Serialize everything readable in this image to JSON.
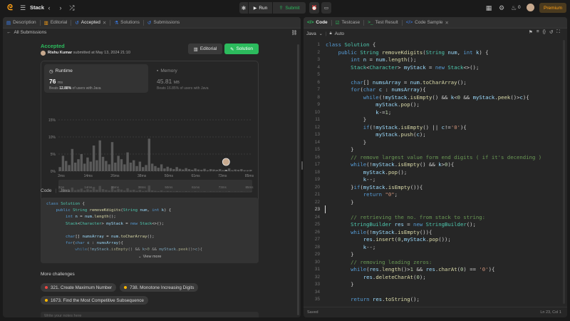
{
  "topbar": {
    "problem_list_label": "Stack",
    "run_label": "Run",
    "submit_label": "Submit",
    "streak_count": "0",
    "premium_label": "Premium"
  },
  "left_tabs": {
    "description": "Description",
    "editorial": "Editorial",
    "accepted": "Accepted",
    "solutions": "Solutions",
    "submissions": "Submissions"
  },
  "submission": {
    "back_label": "All Submissions",
    "status": "Accepted",
    "user": "Rishu Kumar",
    "submitted_at": "submitted at May 13, 2024 21:10",
    "editorial_btn": "Editorial",
    "solution_btn": "Solution",
    "runtime_label": "Runtime",
    "runtime_value": "76",
    "runtime_unit": "ms",
    "runtime_beats_prefix": "Beats",
    "runtime_beats_pct": "12.88%",
    "runtime_beats_suffix": "of users with Java",
    "memory_label": "Memory",
    "memory_value": "45.81",
    "memory_unit": "MB",
    "memory_beats": "Beats 16.85% of users with Java",
    "code_label": "Code",
    "code_lang": "Java",
    "view_more": "View more",
    "more_challenges_title": "More challenges",
    "notes_placeholder": "Write your notes here"
  },
  "challenges": [
    {
      "label": "321. Create Maximum Number",
      "color": "#ef4743"
    },
    {
      "label": "738. Monotone Increasing Digits",
      "color": "#ffb800"
    },
    {
      "label": "1673. Find the Most Competitive Subsequence",
      "color": "#ffb800"
    }
  ],
  "chart_data": {
    "type": "bar",
    "title": "",
    "xlabel": "",
    "ylabel": "",
    "ylim": [
      0,
      15
    ],
    "yticks": [
      "15%",
      "10%",
      "5%",
      "0%"
    ],
    "xticks": [
      "2ms",
      "14ms",
      "26ms",
      "38ms",
      "50ms",
      "61ms",
      "73ms",
      "85ms"
    ],
    "values": [
      1.2,
      4.5,
      3.0,
      1.8,
      6.5,
      2.5,
      3.5,
      5.0,
      2.2,
      4.0,
      2.8,
      7.5,
      3.2,
      9.0,
      4.2,
      3.0,
      2.0,
      8.5,
      2.5,
      4.5,
      3.5,
      2.0,
      5.5,
      2.5,
      3.2,
      1.5,
      2.8,
      1.2,
      1.8,
      9.5,
      2.2,
      1.5,
      1.0,
      2.0,
      0.8,
      1.3,
      0.9,
      0.6,
      1.2,
      0.7,
      0.5,
      0.9,
      0.6,
      0.4,
      0.8,
      0.5,
      0.4,
      0.7,
      0.3,
      0.6,
      0.5,
      0.4,
      0.6,
      0.3,
      0.4,
      0.8,
      0.3,
      0.5,
      0.4,
      0.6,
      0.3,
      0.3,
      0.4
    ],
    "highlight_index": 54,
    "bar_color": "#5a5a5a",
    "highlight_color": "#8a8a8a"
  },
  "editor": {
    "tab_code": "Code",
    "tab_testcase": "Testcase",
    "tab_test_result": "Test Result",
    "tab_code_sample": "Code Sample",
    "language": "Java",
    "auto": "Auto",
    "status_saved": "Saved",
    "cursor_pos": "Ln 23, Col 1",
    "start_line": 1,
    "lines": [
      [
        [
          "kw",
          "class "
        ],
        [
          "ty",
          "Solution "
        ],
        [
          "pl",
          "{"
        ]
      ],
      [
        [
          "pl",
          "    "
        ],
        [
          "kw",
          "public "
        ],
        [
          "ty",
          "String "
        ],
        [
          "fn",
          "removeKdigits"
        ],
        [
          "pl",
          "("
        ],
        [
          "ty",
          "String "
        ],
        [
          "vr",
          "num"
        ],
        [
          "pl",
          ", "
        ],
        [
          "kw",
          "int "
        ],
        [
          "vr",
          "k"
        ],
        [
          "pl",
          ") {"
        ]
      ],
      [
        [
          "pl",
          "        "
        ],
        [
          "kw",
          "int "
        ],
        [
          "vr",
          "n "
        ],
        [
          "pl",
          "= "
        ],
        [
          "vr",
          "num"
        ],
        [
          "pl",
          "."
        ],
        [
          "fn",
          "length"
        ],
        [
          "pl",
          "();"
        ]
      ],
      [
        [
          "pl",
          "        "
        ],
        [
          "ty",
          "Stack"
        ],
        [
          "pl",
          "<"
        ],
        [
          "ty",
          "Character"
        ],
        [
          "pl",
          "> "
        ],
        [
          "vr",
          "myStack "
        ],
        [
          "pl",
          "= "
        ],
        [
          "kw",
          "new "
        ],
        [
          "ty",
          "Stack"
        ],
        [
          "pl",
          "<>();"
        ]
      ],
      [
        [
          "pl",
          ""
        ]
      ],
      [
        [
          "pl",
          "        "
        ],
        [
          "kw",
          "char"
        ],
        [
          "pl",
          "[] "
        ],
        [
          "vr",
          "numsArray "
        ],
        [
          "pl",
          "= "
        ],
        [
          "vr",
          "num"
        ],
        [
          "pl",
          "."
        ],
        [
          "fn",
          "toCharArray"
        ],
        [
          "pl",
          "();"
        ]
      ],
      [
        [
          "pl",
          "        "
        ],
        [
          "kw",
          "for"
        ],
        [
          "pl",
          "("
        ],
        [
          "kw",
          "char "
        ],
        [
          "vr",
          "c "
        ],
        [
          "pl",
          ": "
        ],
        [
          "vr",
          "numsArray"
        ],
        [
          "pl",
          "){"
        ]
      ],
      [
        [
          "pl",
          "            "
        ],
        [
          "kw",
          "while"
        ],
        [
          "pl",
          "(!"
        ],
        [
          "vr",
          "myStack"
        ],
        [
          "pl",
          "."
        ],
        [
          "fn",
          "isEmpty"
        ],
        [
          "pl",
          "() && "
        ],
        [
          "vr",
          "k"
        ],
        [
          "pl",
          "<"
        ],
        [
          "nu",
          "0"
        ],
        [
          "pl",
          " && "
        ],
        [
          "vr",
          "myStack"
        ],
        [
          "pl",
          "."
        ],
        [
          "fn",
          "peek"
        ],
        [
          "pl",
          "()>"
        ],
        [
          "vr",
          "c"
        ],
        [
          "pl",
          "){"
        ]
      ],
      [
        [
          "pl",
          "                "
        ],
        [
          "vr",
          "myStack"
        ],
        [
          "pl",
          "."
        ],
        [
          "fn",
          "pop"
        ],
        [
          "pl",
          "();"
        ]
      ],
      [
        [
          "pl",
          "                "
        ],
        [
          "vr",
          "k"
        ],
        [
          "pl",
          "-="
        ],
        [
          "nu",
          "1"
        ],
        [
          "pl",
          ";"
        ]
      ],
      [
        [
          "pl",
          "            }"
        ]
      ],
      [
        [
          "pl",
          "            "
        ],
        [
          "kw",
          "if"
        ],
        [
          "pl",
          "(!"
        ],
        [
          "vr",
          "myStack"
        ],
        [
          "pl",
          "."
        ],
        [
          "fn",
          "isEmpty"
        ],
        [
          "pl",
          "() || "
        ],
        [
          "vr",
          "c"
        ],
        [
          "pl",
          "!="
        ],
        [
          "st",
          "'0'"
        ],
        [
          "pl",
          "){"
        ]
      ],
      [
        [
          "pl",
          "                "
        ],
        [
          "vr",
          "myStack"
        ],
        [
          "pl",
          "."
        ],
        [
          "fn",
          "push"
        ],
        [
          "pl",
          "("
        ],
        [
          "vr",
          "c"
        ],
        [
          "pl",
          ");"
        ]
      ],
      [
        [
          "pl",
          "            }"
        ]
      ],
      [
        [
          "pl",
          "        }"
        ]
      ],
      [
        [
          "pl",
          "        "
        ],
        [
          "cm",
          "// remove largest value form end digits ( if it's decending )"
        ]
      ],
      [
        [
          "pl",
          "        "
        ],
        [
          "kw",
          "while"
        ],
        [
          "pl",
          "(!"
        ],
        [
          "vr",
          "myStack"
        ],
        [
          "pl",
          "."
        ],
        [
          "fn",
          "isEmpty"
        ],
        [
          "pl",
          "() && "
        ],
        [
          "vr",
          "k"
        ],
        [
          "pl",
          ">"
        ],
        [
          "nu",
          "0"
        ],
        [
          "pl",
          "){"
        ]
      ],
      [
        [
          "pl",
          "            "
        ],
        [
          "vr",
          "myStack"
        ],
        [
          "pl",
          "."
        ],
        [
          "fn",
          "pop"
        ],
        [
          "pl",
          "();"
        ]
      ],
      [
        [
          "pl",
          "            "
        ],
        [
          "vr",
          "k"
        ],
        [
          "pl",
          "--;"
        ]
      ],
      [
        [
          "pl",
          "        }"
        ],
        [
          "kw",
          "if"
        ],
        [
          "pl",
          "("
        ],
        [
          "vr",
          "myStack"
        ],
        [
          "pl",
          "."
        ],
        [
          "fn",
          "isEmpty"
        ],
        [
          "pl",
          "()){"
        ]
      ],
      [
        [
          "pl",
          "            "
        ],
        [
          "kw",
          "return "
        ],
        [
          "st",
          "\"0\""
        ],
        [
          "pl",
          ";"
        ]
      ],
      [
        [
          "pl",
          "        }"
        ]
      ],
      [
        [
          "pl",
          ""
        ]
      ],
      [
        [
          "pl",
          "        "
        ],
        [
          "cm",
          "// retrieving the no. from stack to string:"
        ]
      ],
      [
        [
          "pl",
          "        "
        ],
        [
          "ty",
          "StringBuilder "
        ],
        [
          "vr",
          "res "
        ],
        [
          "pl",
          "= "
        ],
        [
          "kw",
          "new "
        ],
        [
          "ty",
          "StringBuilder"
        ],
        [
          "pl",
          "();"
        ]
      ],
      [
        [
          "pl",
          "        "
        ],
        [
          "kw",
          "while"
        ],
        [
          "pl",
          "(!"
        ],
        [
          "vr",
          "myStack"
        ],
        [
          "pl",
          "."
        ],
        [
          "fn",
          "isEmpty"
        ],
        [
          "pl",
          "()){"
        ]
      ],
      [
        [
          "pl",
          "            "
        ],
        [
          "vr",
          "res"
        ],
        [
          "pl",
          "."
        ],
        [
          "fn",
          "insert"
        ],
        [
          "pl",
          "("
        ],
        [
          "nu",
          "0"
        ],
        [
          "pl",
          ","
        ],
        [
          "vr",
          "myStack"
        ],
        [
          "pl",
          "."
        ],
        [
          "fn",
          "pop"
        ],
        [
          "pl",
          "());"
        ]
      ],
      [
        [
          "pl",
          "            "
        ],
        [
          "vr",
          "k"
        ],
        [
          "pl",
          "--;"
        ]
      ],
      [
        [
          "pl",
          "        }"
        ]
      ],
      [
        [
          "pl",
          "        "
        ],
        [
          "cm",
          "// removing leading zeros:"
        ]
      ],
      [
        [
          "pl",
          "        "
        ],
        [
          "kw",
          "while"
        ],
        [
          "pl",
          "("
        ],
        [
          "vr",
          "res"
        ],
        [
          "pl",
          "."
        ],
        [
          "fn",
          "length"
        ],
        [
          "pl",
          "()>"
        ],
        [
          "nu",
          "1"
        ],
        [
          "pl",
          " && "
        ],
        [
          "vr",
          "res"
        ],
        [
          "pl",
          "."
        ],
        [
          "fn",
          "charAt"
        ],
        [
          "pl",
          "("
        ],
        [
          "nu",
          "0"
        ],
        [
          "pl",
          ") == "
        ],
        [
          "st",
          "'0'"
        ],
        [
          "pl",
          "){"
        ]
      ],
      [
        [
          "pl",
          "            "
        ],
        [
          "vr",
          "res"
        ],
        [
          "pl",
          "."
        ],
        [
          "fn",
          "deleteCharAt"
        ],
        [
          "pl",
          "("
        ],
        [
          "nu",
          "0"
        ],
        [
          "pl",
          ");"
        ]
      ],
      [
        [
          "pl",
          "        }"
        ]
      ],
      [
        [
          "pl",
          ""
        ]
      ],
      [
        [
          "pl",
          "        "
        ],
        [
          "kw",
          "return "
        ],
        [
          "vr",
          "res"
        ],
        [
          "pl",
          "."
        ],
        [
          "fn",
          "toString"
        ],
        [
          "pl",
          "();"
        ]
      ]
    ]
  },
  "snippet": {
    "lines": [
      [
        [
          "kw",
          "class "
        ],
        [
          "ty",
          "Solution "
        ],
        [
          "pl",
          "{"
        ]
      ],
      [
        [
          "pl",
          "    "
        ],
        [
          "kw",
          "public "
        ],
        [
          "ty",
          "String "
        ],
        [
          "fn",
          "removeKdigits"
        ],
        [
          "pl",
          "("
        ],
        [
          "ty",
          "String "
        ],
        [
          "vr",
          "num"
        ],
        [
          "pl",
          ", "
        ],
        [
          "kw",
          "int "
        ],
        [
          "vr",
          "k"
        ],
        [
          "pl",
          ") {"
        ]
      ],
      [
        [
          "pl",
          "        "
        ],
        [
          "kw",
          "int "
        ],
        [
          "vr",
          "n "
        ],
        [
          "pl",
          "= "
        ],
        [
          "vr",
          "num"
        ],
        [
          "pl",
          "."
        ],
        [
          "fn",
          "length"
        ],
        [
          "pl",
          "();"
        ]
      ],
      [
        [
          "pl",
          "        "
        ],
        [
          "ty",
          "Stack"
        ],
        [
          "pl",
          "<"
        ],
        [
          "ty",
          "Character"
        ],
        [
          "pl",
          "> "
        ],
        [
          "vr",
          "myStack "
        ],
        [
          "pl",
          "= "
        ],
        [
          "kw",
          "new "
        ],
        [
          "ty",
          "Stack"
        ],
        [
          "pl",
          "<>();"
        ]
      ],
      [
        [
          "pl",
          ""
        ]
      ],
      [
        [
          "pl",
          "        "
        ],
        [
          "kw",
          "char"
        ],
        [
          "pl",
          "[] "
        ],
        [
          "vr",
          "numsArray "
        ],
        [
          "pl",
          "= "
        ],
        [
          "vr",
          "num"
        ],
        [
          "pl",
          "."
        ],
        [
          "fn",
          "toCharArray"
        ],
        [
          "pl",
          "();"
        ]
      ],
      [
        [
          "pl",
          "        "
        ],
        [
          "kw",
          "for"
        ],
        [
          "pl",
          "("
        ],
        [
          "kw",
          "char "
        ],
        [
          "vr",
          "c "
        ],
        [
          "pl",
          ": "
        ],
        [
          "vr",
          "numsArray"
        ],
        [
          "pl",
          "){"
        ]
      ],
      [
        [
          "pl",
          "            "
        ],
        [
          "kw",
          "while"
        ],
        [
          "pl",
          "(!"
        ],
        [
          "vr",
          "myStack"
        ],
        [
          "pl",
          "."
        ],
        [
          "fn",
          "isEmpty"
        ],
        [
          "pl",
          "() && "
        ],
        [
          "vr",
          "k"
        ],
        [
          "pl",
          ">"
        ],
        [
          "nu",
          "0"
        ],
        [
          "pl",
          " && "
        ],
        [
          "vr",
          "myStack"
        ],
        [
          "pl",
          "."
        ],
        [
          "fn",
          "peek"
        ],
        [
          "pl",
          "()>"
        ],
        [
          "vr",
          "c"
        ],
        [
          "pl",
          "){"
        ]
      ]
    ]
  }
}
